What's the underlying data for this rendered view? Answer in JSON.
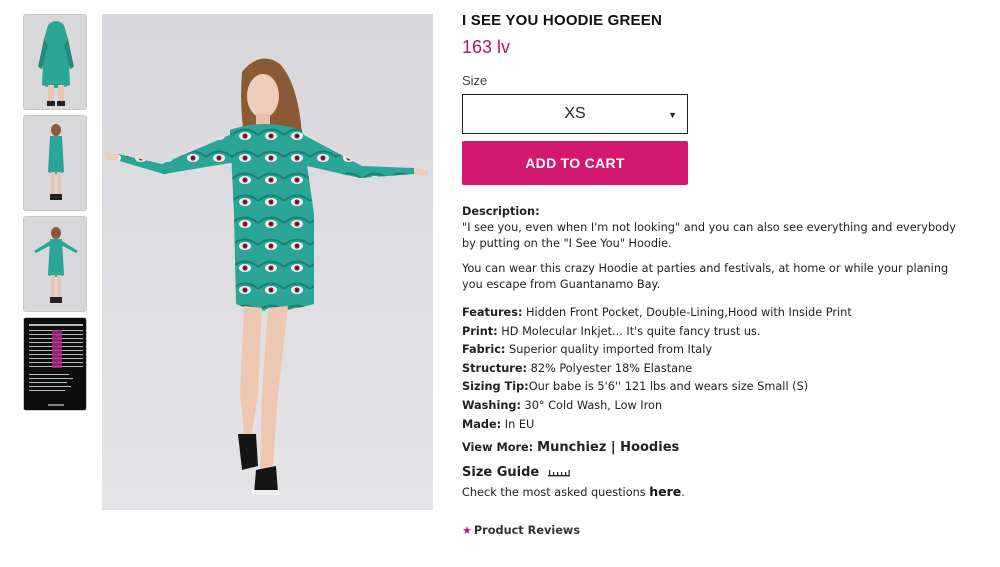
{
  "product": {
    "title": "I SEE YOU HOODIE GREEN",
    "price": "163 lv"
  },
  "size": {
    "label": "Size",
    "selected": "XS",
    "caret": "▼"
  },
  "cart": {
    "button_label": "ADD TO CART"
  },
  "description": {
    "title": "Description:",
    "para1": "\"I see you, even when I'm not looking\" and you can also see everything and everybody by putting on the \"I See You\" Hoodie.",
    "para2": "You can wear this crazy Hoodie at parties and festivals, at home or while your planing you escape from Guantanamo Bay."
  },
  "features": [
    {
      "label": "Features:",
      "value": " Hidden Front Pocket, Double-Lining,Hood with Inside Print"
    },
    {
      "label": "Print:",
      "value": " HD Molecular Inkjet... It's quite fancy trust us."
    },
    {
      "label": "Fabric:",
      "value": " Superior quality imported from Italy"
    },
    {
      "label": "Structure:",
      "value": " 82% Polyester 18% Elastane"
    },
    {
      "label": "Sizing Tip:",
      "value": "Our babe is 5'6'' 121 lbs and wears size Small (S)"
    },
    {
      "label": "Washing:",
      "value": " 30° Cold Wash, Low Iron"
    },
    {
      "label": "Made:",
      "value": " In EU"
    }
  ],
  "view_more": {
    "label": "View More: ",
    "links": "Munchiez | Hoodies"
  },
  "size_guide": {
    "title": "Size Guide",
    "questions_text": "Check the most asked questions ",
    "questions_link": "here",
    "questions_end": "."
  },
  "reviews": {
    "label": "Product Reviews"
  },
  "colors": {
    "accent": "#d3186f",
    "price": "#b3176d",
    "hoodie": "#2aa596"
  }
}
